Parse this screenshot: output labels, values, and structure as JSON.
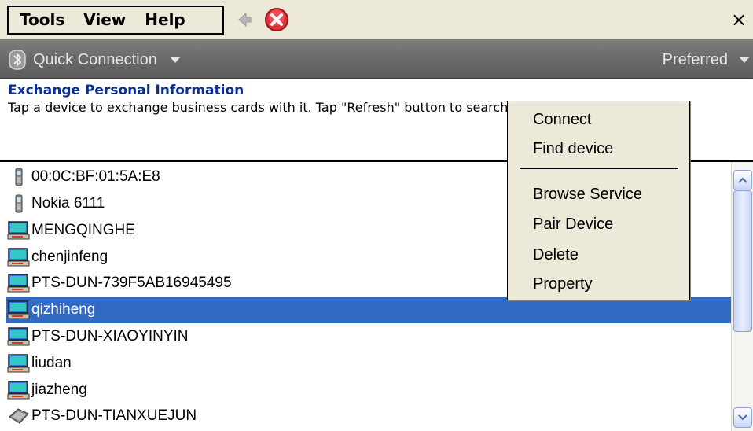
{
  "menubar": {
    "items": [
      "Tools",
      "View",
      "Help"
    ],
    "close_label": "×"
  },
  "toolbar": {
    "quick_connection": "Quick Connection",
    "preferred": "Preferred"
  },
  "info": {
    "title": "Exchange Personal Information",
    "text": "Tap a device to exchange business cards with it. Tap \"Refresh\" button to search for devices again."
  },
  "devices": [
    {
      "name": "00:0C:BF:01:5A:E8",
      "icon": "phone-icon"
    },
    {
      "name": "Nokia 6111",
      "icon": "phone-icon"
    },
    {
      "name": "MENGQINGHE",
      "icon": "computer-icon"
    },
    {
      "name": "chenjinfeng",
      "icon": "computer-icon"
    },
    {
      "name": "PTS-DUN-739F5AB16945495",
      "icon": "computer-icon"
    },
    {
      "name": "qizhiheng",
      "icon": "computer-icon",
      "selected": true
    },
    {
      "name": "PTS-DUN-XIAOYINYIN",
      "icon": "computer-icon"
    },
    {
      "name": "liudan",
      "icon": "computer-icon"
    },
    {
      "name": "jiazheng",
      "icon": "computer-icon"
    },
    {
      "name": "PTS-DUN-TIANXUEJUN",
      "icon": "device-icon"
    }
  ],
  "context_menu": {
    "items": [
      "Connect",
      "Find device",
      "Browse Service",
      "Pair Device",
      "Delete",
      "Property"
    ]
  },
  "colors": {
    "selection": "#316ac5",
    "title": "#0a2f8f",
    "toolbar": "#6a6a6a"
  }
}
